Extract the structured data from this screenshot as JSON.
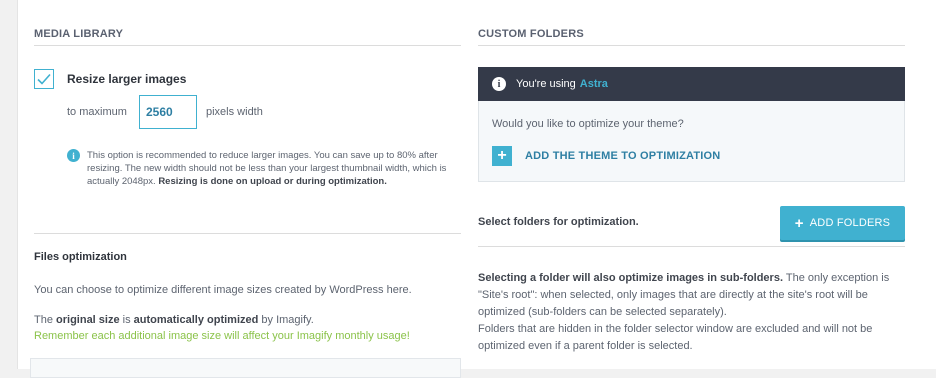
{
  "media_library": {
    "title": "MEDIA LIBRARY",
    "resize_label": "Resize larger images",
    "max_prefix": "to maximum",
    "max_value": "2560",
    "max_suffix": "pixels width",
    "note_plain": "This option is recommended to reduce larger images. You can save up to 80% after resizing. The new width should not be less than your largest thumbnail width, which is actually 2048px.",
    "note_bold": "Resizing is done on upload or during optimization."
  },
  "files_optimization": {
    "title": "Files optimization",
    "p1": "You can choose to optimize different image sizes created by WordPress here.",
    "p2_a": "The ",
    "p2_b": "original size",
    "p2_c": " is ",
    "p2_d": "automatically optimized",
    "p2_e": " by Imagify.",
    "warning": "Remember each additional image size will affect your Imagify monthly usage!"
  },
  "custom_folders": {
    "title": "CUSTOM FOLDERS",
    "banner_prefix": "You're using",
    "theme_name": "Astra",
    "theme_question": "Would you like to optimize your theme?",
    "add_theme": "ADD THE THEME TO OPTIMIZATION",
    "select_title": "Select folders for optimization.",
    "add_folders": "ADD FOLDERS",
    "note_bold": "Selecting a folder will also optimize images in sub-folders.",
    "note_rest": " The only exception is \"Site's root\": when selected, only images that are directly at the site's root will be optimized (sub-folders can be selected separately).",
    "note_2": "Folders that are hidden in the folder selector window are excluded and will not be optimized even if a parent folder is selected."
  },
  "colors": {
    "accent": "#40b1d0",
    "link": "#2e7fa3",
    "banner_bg": "#343a49",
    "warning_green": "#8bc34a"
  }
}
